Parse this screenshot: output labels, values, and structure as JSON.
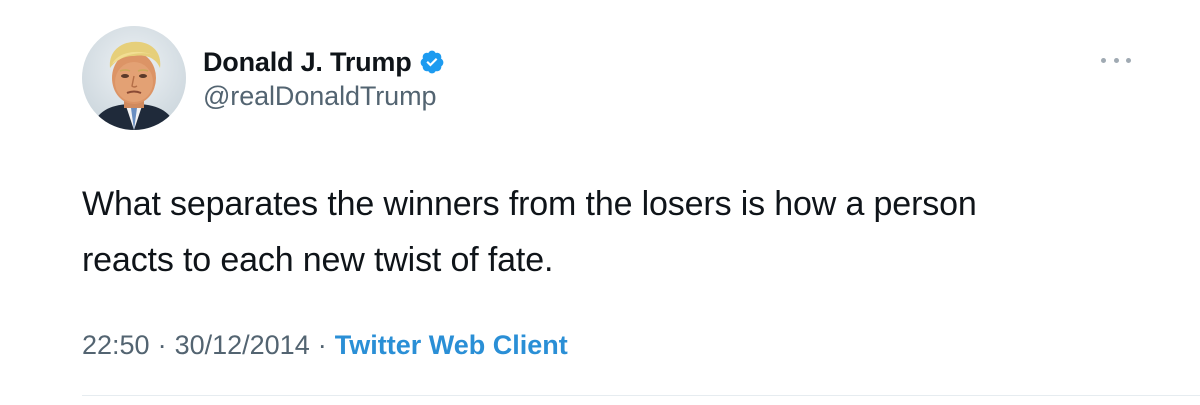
{
  "author": {
    "display_name": "Donald J. Trump",
    "handle": "@realDonaldTrump",
    "verified": true,
    "verified_icon": "verified-badge-icon",
    "avatar_icon": "avatar"
  },
  "tweet": {
    "text_line1": "What separates the winners from the losers is how a person",
    "text_line2": "reacts to each new twist of fate."
  },
  "meta": {
    "time": "22:50",
    "date": "30/12/2014",
    "separator": "·",
    "source": "Twitter Web Client"
  },
  "colors": {
    "text": "#0f1419",
    "secondary": "#536471",
    "link": "#2a8fd6",
    "verified": "#1d9bf0",
    "divider": "#e6ecf0"
  },
  "more_icon": "more-options-icon"
}
